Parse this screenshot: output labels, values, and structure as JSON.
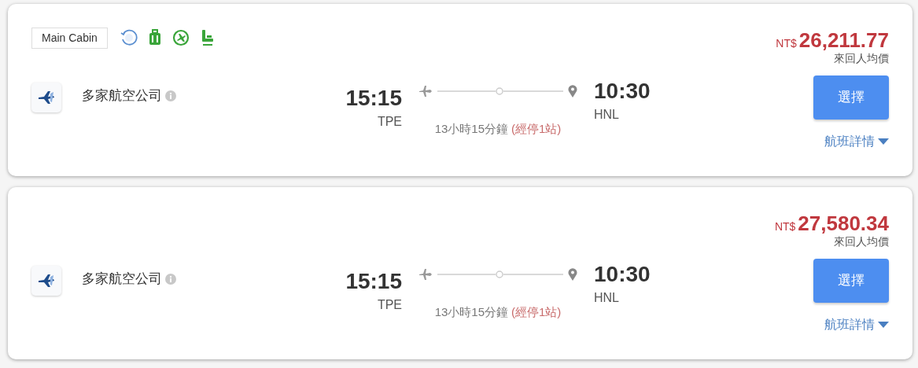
{
  "flights": [
    {
      "cabin": "Main Cabin",
      "amenities": [
        {
          "kind": "refund_24"
        },
        {
          "kind": "baggage"
        },
        {
          "kind": "flight_change"
        },
        {
          "kind": "seat"
        }
      ],
      "airline": "多家航空公司",
      "depart_time": "15:15",
      "depart_airport": "TPE",
      "arrive_time": "10:30",
      "arrive_airport": "HNL",
      "duration": "13小時15分鐘",
      "stops": "(經停1站)",
      "currency": "NT$",
      "price": "26,211.77",
      "price_note": "來回人均價",
      "select_label": "選擇",
      "details_label": "航班詳情"
    },
    {
      "airline": "多家航空公司",
      "depart_time": "15:15",
      "depart_airport": "TPE",
      "arrive_time": "10:30",
      "arrive_airport": "HNL",
      "duration": "13小時15分鐘",
      "stops": "(經停1站)",
      "currency": "NT$",
      "price": "27,580.34",
      "price_note": "來回人均價",
      "select_label": "選擇",
      "details_label": "航班詳情"
    }
  ]
}
